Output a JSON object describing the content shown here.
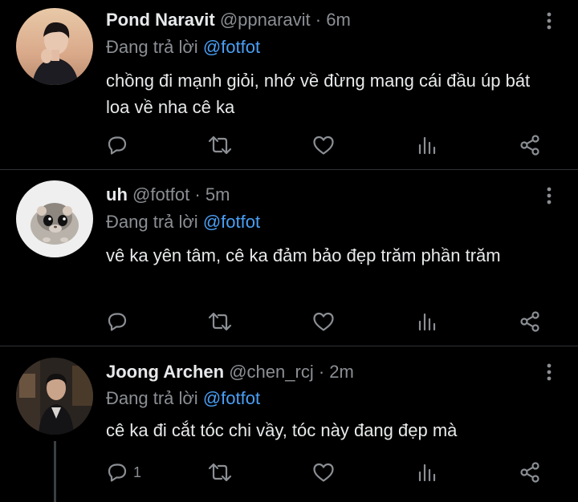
{
  "tweets": [
    {
      "name": "Pond Naravit",
      "handle": "@ppnaravit",
      "sep": "·",
      "time": "6m",
      "replying_prefix": "Đang trả lời",
      "replying_to": "@fotfot",
      "text": "chồng đi mạnh giỏi, nhớ về đừng mang cái đầu úp bát loa về nha cê ka",
      "reply_count": "",
      "avatar_icon": "person-photo-avatar"
    },
    {
      "name": "uh",
      "handle": "@fotfot",
      "sep": "·",
      "time": "5m",
      "replying_prefix": "Đang trả lời",
      "replying_to": "@fotfot",
      "text": "vê ka yên tâm, cê ka đảm bảo đẹp trăm phần trăm",
      "reply_count": "",
      "avatar_icon": "hamster-avatar"
    },
    {
      "name": "Joong Archen",
      "handle": "@chen_rcj",
      "sep": "·",
      "time": "2m",
      "replying_prefix": "Đang trả lời",
      "replying_to": "@fotfot",
      "text": "cê ka đi cắt tóc chi vầy, tóc này đang đẹp mà",
      "reply_count": "1",
      "avatar_icon": "person-suit-avatar"
    }
  ],
  "icons": {
    "reply": "reply-icon",
    "retweet": "retweet-icon",
    "like": "heart-icon",
    "views": "views-icon",
    "share": "share-icon",
    "more": "more-vertical-icon"
  },
  "colors": {
    "background": "#000000",
    "text": "#e7e9ea",
    "muted": "#8b8f94",
    "mention": "#4a9ff5",
    "divider": "#2f3336"
  }
}
